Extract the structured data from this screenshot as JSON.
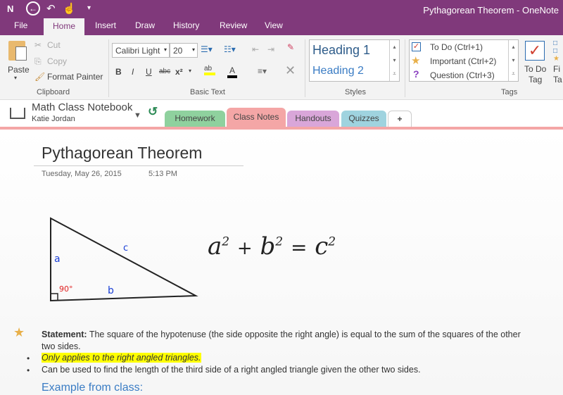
{
  "window": {
    "title": "Pythagorean Theorem - OneNote"
  },
  "quick_access": {
    "app_icon": "N",
    "back": "back-icon",
    "undo": "undo-icon",
    "touch": "touch-mode-icon",
    "more": "customize-icon"
  },
  "ribbon_tabs": [
    "File",
    "Home",
    "Insert",
    "Draw",
    "History",
    "Review",
    "View"
  ],
  "clipboard": {
    "paste": "Paste",
    "cut": "Cut",
    "copy": "Copy",
    "format_painter": "Format Painter",
    "group": "Clipboard"
  },
  "basic_text": {
    "font": "Calibri Light",
    "size": "20",
    "bold": "B",
    "italic": "I",
    "underline": "U",
    "strike": "abc",
    "superscript": "x²",
    "highlight": "ab",
    "font_color": "A",
    "group": "Basic Text"
  },
  "styles": {
    "items": [
      "Heading 1",
      "Heading 2"
    ],
    "group": "Styles"
  },
  "tags": {
    "items": [
      "To Do (Ctrl+1)",
      "Important (Ctrl+2)",
      "Question (Ctrl+3)"
    ],
    "todo_tag_1": "To Do",
    "todo_tag_2": "Tag",
    "find_1": "Fi",
    "find_2": "Ta",
    "group": "Tags"
  },
  "notebook": {
    "name": "Math Class Notebook",
    "owner": "Katie Jordan"
  },
  "sections": [
    {
      "label": "Homework",
      "color": "#8fd19e"
    },
    {
      "label": "Class Notes",
      "color": "#f4a6a6"
    },
    {
      "label": "Handouts",
      "color": "#d9a6d9"
    },
    {
      "label": "Quizzes",
      "color": "#9fd3df"
    },
    {
      "label": "+",
      "color": "#ffffff"
    }
  ],
  "page": {
    "title": "Pythagorean Theorem",
    "date": "Tuesday, May 26, 2015",
    "time": "5:13 PM"
  },
  "drawing": {
    "a": "a",
    "b": "b",
    "c": "c",
    "angle": "90°",
    "eq_a": "a",
    "eq_b": "b",
    "eq_c": "c",
    "eq_2": "2",
    "plus": "+",
    "equals": "="
  },
  "notes": {
    "statement_label": "Statement:",
    "statement": " The square of the hypotenuse (the side opposite the right angle) is equal to the sum of the squares of the other two sides.",
    "bullets": [
      "Only applies to the right angled triangles.",
      "Can be used to find the length of the third side of a right angled triangle given the other two sides."
    ],
    "example_heading": "Example from class:"
  }
}
